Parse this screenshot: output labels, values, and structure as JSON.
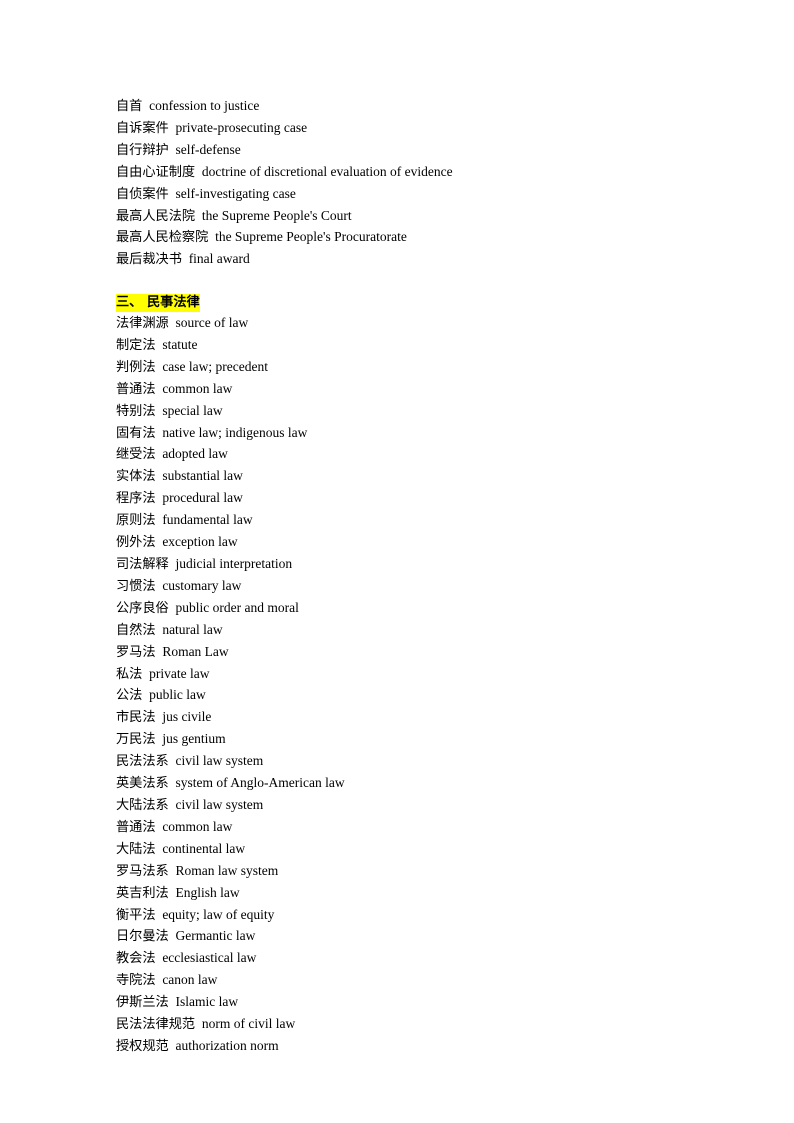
{
  "document": {
    "page_background": "#ffffff",
    "text_color": "#000000",
    "highlight_color": "#ffff00",
    "blocks": [
      {
        "type": "glossary-list",
        "entries": [
          {
            "term": "自首",
            "definition": "confession to justice"
          },
          {
            "term": "自诉案件",
            "definition": "private-prosecuting case"
          },
          {
            "term": "自行辩护",
            "definition": "self-defense"
          },
          {
            "term": "自由心证制度",
            "definition": "doctrine of discretional evaluation of evidence"
          },
          {
            "term": "自侦案件",
            "definition": "self-investigating case"
          },
          {
            "term": "最高人民法院",
            "definition": "the Supreme People's Court"
          },
          {
            "term": "最高人民检察院",
            "definition": "the Supreme People's Procuratorate"
          },
          {
            "term": "最后裁决书",
            "definition": "final award"
          }
        ]
      },
      {
        "type": "blank-line"
      },
      {
        "type": "section-heading",
        "text": "三、 民事法律",
        "highlighted": true,
        "bold": true
      },
      {
        "type": "glossary-list",
        "entries": [
          {
            "term": "法律渊源",
            "definition": "source of law"
          },
          {
            "term": "制定法",
            "definition": "statute"
          },
          {
            "term": "判例法",
            "definition": "case law; precedent"
          },
          {
            "term": "普通法",
            "definition": "common law"
          },
          {
            "term": "特别法",
            "definition": "special law"
          },
          {
            "term": "固有法",
            "definition": "native law; indigenous law"
          },
          {
            "term": "继受法",
            "definition": "adopted law"
          },
          {
            "term": "实体法",
            "definition": "substantial law"
          },
          {
            "term": "程序法",
            "definition": "procedural law"
          },
          {
            "term": "原则法",
            "definition": "fundamental law"
          },
          {
            "term": "例外法",
            "definition": "exception law"
          },
          {
            "term": "司法解释",
            "definition": "judicial interpretation"
          },
          {
            "term": "习惯法",
            "definition": "customary law"
          },
          {
            "term": "公序良俗",
            "definition": "public order and moral"
          },
          {
            "term": "自然法",
            "definition": "natural law"
          },
          {
            "term": "罗马法",
            "definition": "Roman Law"
          },
          {
            "term": "私法",
            "definition": "private law"
          },
          {
            "term": "公法",
            "definition": "public law"
          },
          {
            "term": "市民法",
            "definition": "jus civile"
          },
          {
            "term": "万民法",
            "definition": "jus gentium"
          },
          {
            "term": "民法法系",
            "definition": "civil law system"
          },
          {
            "term": "英美法系",
            "definition": "system of Anglo-American law"
          },
          {
            "term": "大陆法系",
            "definition": "civil law system"
          },
          {
            "term": "普通法",
            "definition": "common law"
          },
          {
            "term": "大陆法",
            "definition": "continental law"
          },
          {
            "term": "罗马法系",
            "definition": "Roman law system"
          },
          {
            "term": "英吉利法",
            "definition": "English law"
          },
          {
            "term": "衡平法",
            "definition": "equity; law of equity"
          },
          {
            "term": "日尔曼法",
            "definition": "Germantic law"
          },
          {
            "term": "教会法",
            "definition": "ecclesiastical law"
          },
          {
            "term": "寺院法",
            "definition": "canon law"
          },
          {
            "term": "伊斯兰法",
            "definition": "Islamic law"
          },
          {
            "term": "民法法律规范",
            "definition": "norm of civil law"
          },
          {
            "term": "授权规范",
            "definition": "authorization norm"
          }
        ]
      }
    ]
  }
}
